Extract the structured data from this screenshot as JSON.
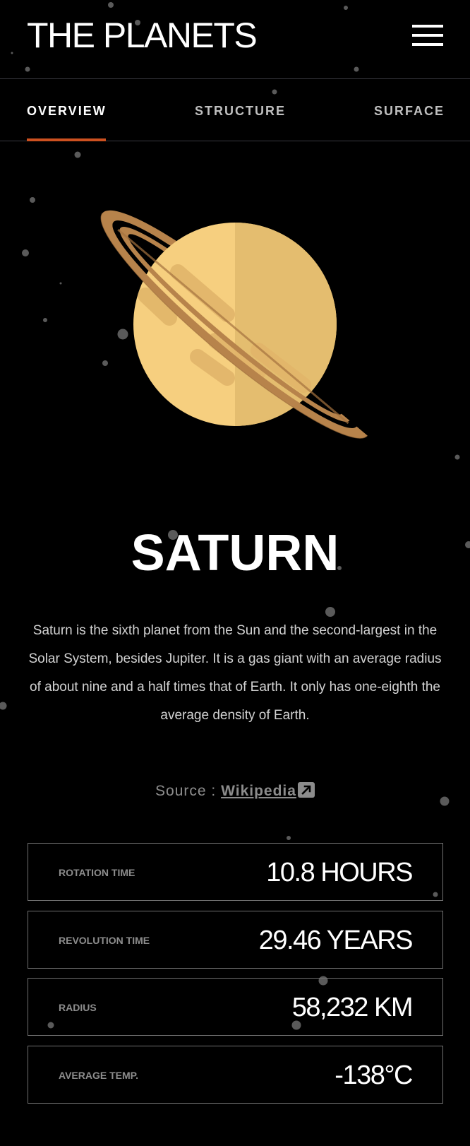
{
  "header": {
    "logo": "THE PLANETS",
    "menu_icon": "hamburger-menu-icon"
  },
  "tabs": [
    {
      "label": "OVERVIEW",
      "active": true
    },
    {
      "label": "STRUCTURE",
      "active": false
    },
    {
      "label": "SURFACE",
      "active": false
    }
  ],
  "planet": {
    "name": "SATURN",
    "description": "Saturn is the sixth planet from the Sun and the second-largest in the Solar System, besides Jupiter. It is a gas giant with an average radius of about nine and a half times that of Earth. It only has one-eighth the average density of Earth.",
    "source_prefix": "Source : ",
    "source_link": "Wikipedia",
    "source_icon": "external-link-icon"
  },
  "stats": [
    {
      "label": "ROTATION TIME",
      "value": "10.8 HOURS"
    },
    {
      "label": "REVOLUTION TIME",
      "value": "29.46 YEARS"
    },
    {
      "label": "RADIUS",
      "value": "58,232 KM"
    },
    {
      "label": "AVERAGE TEMP.",
      "value": "-138°C"
    }
  ],
  "colors": {
    "background": "#000000",
    "accent": "#cd5120",
    "divider": "#38383f",
    "planet_light": "#f6cf7f",
    "planet_dark": "#e4bd6f",
    "ring": "#b7834b"
  }
}
